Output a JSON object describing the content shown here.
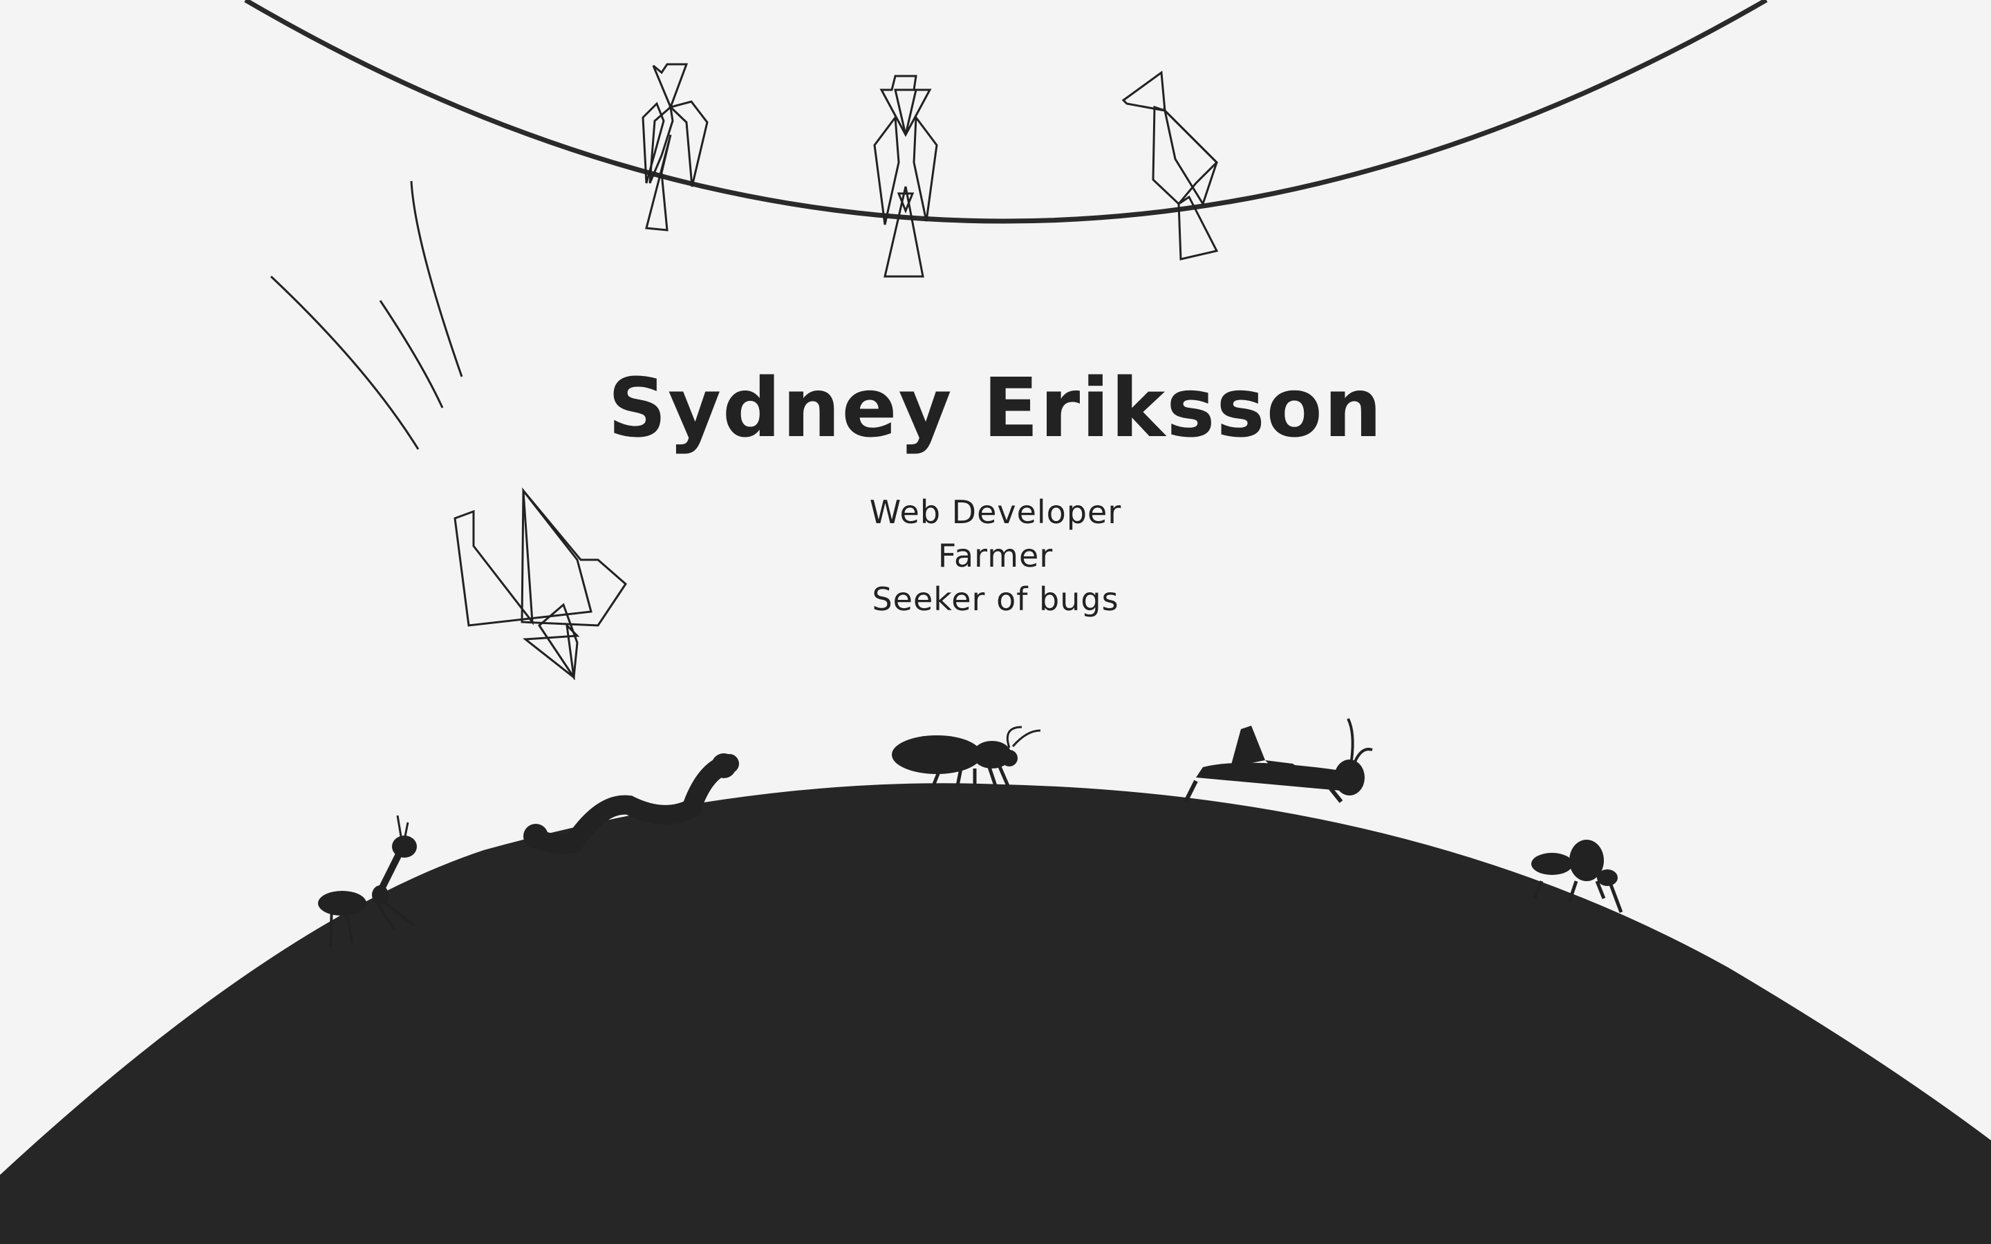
{
  "profile": {
    "name": "Sydney Eriksson",
    "roles": [
      "Web Developer",
      "Farmer",
      "Seeker of bugs"
    ]
  },
  "colors": {
    "background": "#f4f4f4",
    "ink": "#222222",
    "ground": "#262626"
  },
  "icons": {
    "birds": [
      "bird-icon",
      "bird-icon",
      "bird-icon"
    ],
    "flying_bird": "flying-bird-icon",
    "bugs": [
      "ant-icon",
      "worm-icon",
      "beetle-icon",
      "grasshopper-icon",
      "fly-icon"
    ]
  }
}
